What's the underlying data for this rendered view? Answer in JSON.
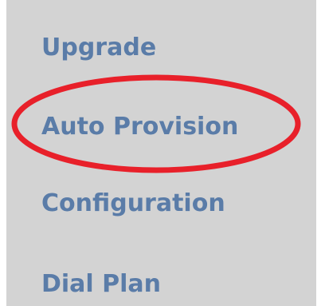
{
  "menu": {
    "items": [
      {
        "label": "Upgrade"
      },
      {
        "label": "Auto Provision"
      },
      {
        "label": "Configuration"
      },
      {
        "label": "Dial Plan"
      }
    ]
  },
  "highlight": {
    "target": "Auto Provision",
    "color": "#e8202a"
  },
  "colors": {
    "panel": "#d3d3d3",
    "link": "#5a7ca8"
  }
}
